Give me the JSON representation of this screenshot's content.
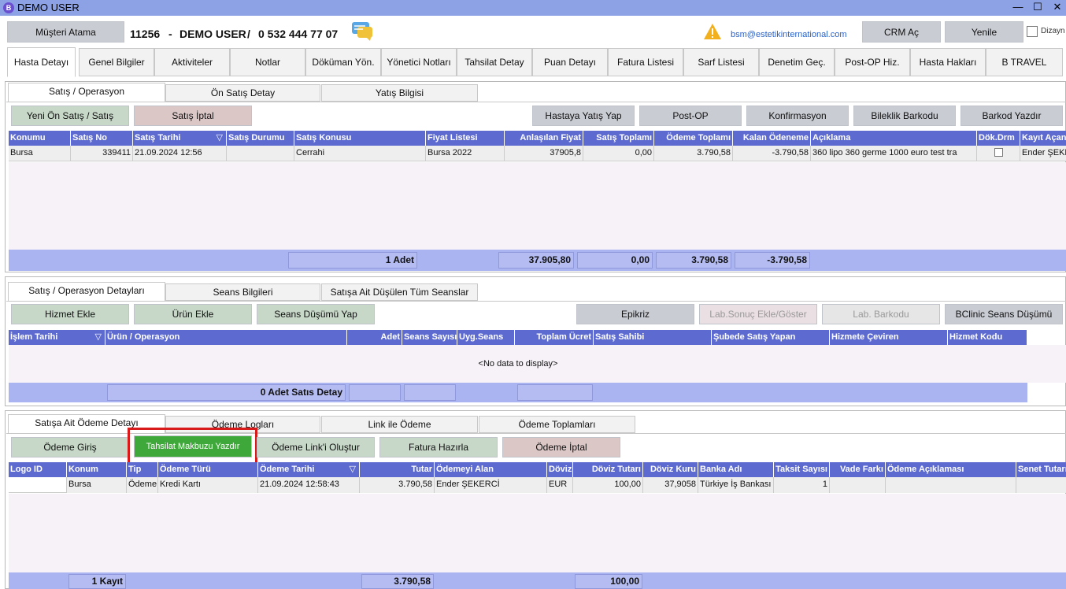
{
  "window": {
    "title": "DEMO USER",
    "app_icon_letter": "B"
  },
  "header": {
    "assign_button": "Müşteri Atama",
    "patient_id": "11256",
    "separator1": "-",
    "patient_name": "DEMO USER",
    "separator2": "/",
    "phone": "0 532 444 77 07",
    "email": "bsm@estetikinternational.com",
    "crm_button": "CRM Aç",
    "refresh_button": "Yenile",
    "design_label": "Dizayn"
  },
  "main_tabs": [
    "Hasta Detayı",
    "Genel Bilgiler",
    "Aktiviteler",
    "Notlar",
    "Döküman Yön.",
    "Yönetici Notları",
    "Tahsilat Detay",
    "Puan Detayı",
    "Fatura Listesi",
    "Sarf Listesi",
    "Denetim Geç.",
    "Post-OP Hiz.",
    "Hasta Hakları",
    "B TRAVEL"
  ],
  "sales": {
    "tabs": [
      "Satış / Operasyon",
      "Ön Satış Detay",
      "Yatış Bilgisi"
    ],
    "buttons": {
      "new_sale": "Yeni Ön Satış / Satış",
      "cancel_sale": "Satış İptal",
      "admit": "Hastaya Yatış Yap",
      "postop": "Post-OP",
      "confirm": "Konfirmasyon",
      "bracelet": "Bileklik Barkodu",
      "print_barcode": "Barkod Yazdır"
    },
    "columns": [
      "Konumu",
      "Satış No",
      "Satış Tarihi",
      "Satış Durumu",
      "Satış Konusu",
      "Fiyat Listesi",
      "Anlaşılan Fiyat",
      "Satış Toplamı",
      "Ödeme Toplamı",
      "Kalan Ödeneme",
      "Açıklama",
      "Dök.Drm",
      "Kayıt Açan"
    ],
    "rows": [
      {
        "location": "Bursa",
        "sale_no": "339411",
        "date": "21.09.2024 12:56",
        "status": "",
        "subject": "Cerrahi",
        "price_list": "Bursa 2022",
        "agreed": "37905,8",
        "sale_total": "0,00",
        "paid_total": "3.790,58",
        "remaining": "-3.790,58",
        "desc": "360 lipo 360 germe 1000 euro test tra",
        "opened_by": "Ender ŞEKERC"
      }
    ],
    "footer": {
      "count": "1 Adet",
      "agreed": "37.905,80",
      "sale_total": "0,00",
      "paid_total": "3.790,58",
      "remaining": "-3.790,58"
    }
  },
  "details": {
    "tabs": [
      "Satış / Operasyon Detayları",
      "Seans Bilgileri",
      "Satışa Ait Düşülen Tüm Seanslar"
    ],
    "buttons": {
      "add_service": "Hizmet Ekle",
      "add_product": "Ürün Ekle",
      "session_deduct": "Seans Düşümü Yap",
      "epicrisis": "Epikriz",
      "lab_result": "Lab.Sonuç Ekle/Göster",
      "lab_barcode": "Lab. Barkodu",
      "bclinic": "BClinic Seans Düşümü"
    },
    "columns": [
      "İşlem Tarihi",
      "Ürün / Operasyon",
      "Adet",
      "Seans Sayısı",
      "Uyg.Seans",
      "Toplam Ücret",
      "Satış Sahibi",
      "Şubede Satış Yapan",
      "Hizmete Çeviren",
      "Hizmet Kodu"
    ],
    "empty": "<No data to display>",
    "footer": {
      "count": "0 Adet Satıs Detay"
    }
  },
  "payments": {
    "tabs": [
      "Satışa Ait Ödeme Detayı",
      "Ödeme Logları",
      "Link ile Ödeme",
      "Ödeme Toplamları"
    ],
    "buttons": {
      "payment_entry": "Ödeme Giriş",
      "print_receipt": "Tahsilat Makbuzu Yazdır",
      "payment_link": "Ödeme Link'i Oluştur",
      "invoice": "Fatura Hazırla",
      "cancel_payment": "Ödeme İptal"
    },
    "columns": [
      "Logo ID",
      "Konum",
      "Tip",
      "Ödeme Türü",
      "Ödeme Tarihi",
      "Tutar",
      "Ödemeyi Alan",
      "Döviz",
      "Döviz Tutarı",
      "Döviz Kuru",
      "Banka Adı",
      "Taksit Sayısı",
      "Vade Farkı",
      "Ödeme Açıklaması",
      "Senet Tutarı"
    ],
    "rows": [
      {
        "logo_id": "",
        "location": "Bursa",
        "type": "Ödeme",
        "pay_type": "Kredi Kartı",
        "date": "21.09.2024 12:58:43",
        "amount": "3.790,58",
        "received_by": "Ender ŞEKERCİ",
        "currency": "EUR",
        "fx_amount": "100,00",
        "fx_rate": "37,9058",
        "bank": "Türkiye İş Bankası",
        "installments": "1",
        "late_fee": "",
        "note": "",
        "bond": ""
      }
    ],
    "footer": {
      "count": "1 Kayıt",
      "amount": "3.790,58",
      "fx_amount": "100,00"
    }
  }
}
